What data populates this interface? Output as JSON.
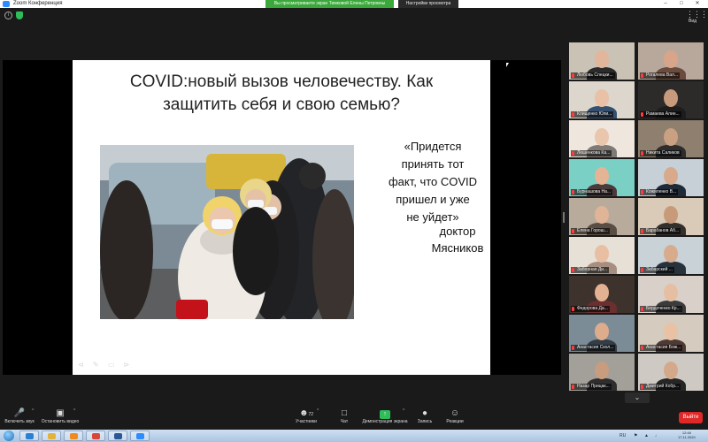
{
  "window": {
    "title": "Zoom Конференция",
    "share_notice": "Вы просматриваете экран Тимковой Елены Петровны",
    "view_options": "Настройки просмотра",
    "minimize": "–",
    "maximize": "□",
    "close": "✕"
  },
  "topbar": {
    "info_glyph": "i",
    "more_glyph": "⋮⋮⋮",
    "view_label": "Вид"
  },
  "slide": {
    "title_line1": "COVID:новый вызов человечеству. Как",
    "title_line2": "защитить себя и свою семью?",
    "quote_line1": "«Придется",
    "quote_line2": "принять тот",
    "quote_line3": "факт, что COVID",
    "quote_line4": "пришел и уже",
    "quote_line5": "не уйдет»",
    "author_line1": "доктор",
    "author_line2": "Мясников",
    "tools": "⊲ ✎ ▭ ⊳"
  },
  "participants": [
    {
      "name": "Любовь Слецки...",
      "bg": "#c9c2b5",
      "skin": "#e2b69a",
      "cloth": "#2b2b2b",
      "active": true
    },
    {
      "name": "Рогалева Вал...",
      "bg": "#b8a89c",
      "skin": "#d8a58a",
      "cloth": "#6b4b3e"
    },
    {
      "name": "Клищенко Юли...",
      "bg": "#dcd6cc",
      "skin": "#e8c1a6",
      "cloth": "#35506e"
    },
    {
      "name": "Рамаева Алин...",
      "bg": "#2d2a2a",
      "skin": "#c89a7c",
      "cloth": "#1d1d1d"
    },
    {
      "name": "Лешенкова Ка...",
      "bg": "#efe6dd",
      "skin": "#e9c6ac",
      "cloth": "#7f7a76"
    },
    {
      "name": "Никита Саликов",
      "bg": "#8e7f6f",
      "skin": "#caa083",
      "cloth": "#2d2d2d"
    },
    {
      "name": "Бурнашова На...",
      "bg": "#7ad0c4",
      "skin": "#e4b494",
      "cloth": "#4b3a3a"
    },
    {
      "name": "Кожиленко В...",
      "bg": "#c7d0d6",
      "skin": "#d9a98b",
      "cloth": "#1e2a38"
    },
    {
      "name": "Елена Горош...",
      "bg": "#b8ab9c",
      "skin": "#e0b597",
      "cloth": "#5a4d44"
    },
    {
      "name": "Барабанов Аб...",
      "bg": "#d9cbb8",
      "skin": "#c79a79",
      "cloth": "#33302c"
    },
    {
      "name": "Заборная Ди...",
      "bg": "#e7e0d6",
      "skin": "#e8bfa2",
      "cloth": "#a68e80"
    },
    {
      "name": "Забарский ...",
      "bg": "#c8d2d7",
      "skin": "#d9ab8d",
      "cloth": "#27323c"
    },
    {
      "name": "Федорова Да...",
      "bg": "#3d322c",
      "skin": "#e2b293",
      "cloth": "#6b2f2f"
    },
    {
      "name": "Бердоченко Кр...",
      "bg": "#d8d0c9",
      "skin": "#e6bfa3",
      "cloth": "#3b3b3b"
    },
    {
      "name": "Анастасия Скол...",
      "bg": "#7c8c96",
      "skin": "#dcac8d",
      "cloth": "#343c45"
    },
    {
      "name": "Анастасия Бож...",
      "bg": "#d5cbbf",
      "skin": "#e9c2a5",
      "cloth": "#4e3a35"
    },
    {
      "name": "Назар Прицак...",
      "bg": "#a3a09a",
      "skin": "#c89c7f",
      "cloth": "#2e2e2e"
    },
    {
      "name": "Дмитрий Кобр...",
      "bg": "#cfc9c3",
      "skin": "#d4a98b",
      "cloth": "#262626"
    }
  ],
  "gallery_next": "⌄",
  "toolbar": {
    "audio_label": "Включить звук",
    "video_label": "Остановить видео",
    "participants_label": "Участники",
    "participants_count": "72",
    "chat_label": "Чат",
    "share_label": "Демонстрация экрана",
    "record_label": "Запись",
    "reactions_label": "Реакции",
    "leave_label": "Выйти",
    "caret": "^"
  },
  "taskbar": {
    "apps": [
      {
        "name": "ie",
        "color": "#2b7fd4"
      },
      {
        "name": "explorer",
        "color": "#e3b23c"
      },
      {
        "name": "media",
        "color": "#f08a1c"
      },
      {
        "name": "chrome",
        "color": "#db4437"
      },
      {
        "name": "word",
        "color": "#2b5797"
      },
      {
        "name": "zoom",
        "color": "#2d8cff"
      }
    ],
    "lang": "RU",
    "time": "12:46",
    "date": "17.11.2020"
  }
}
